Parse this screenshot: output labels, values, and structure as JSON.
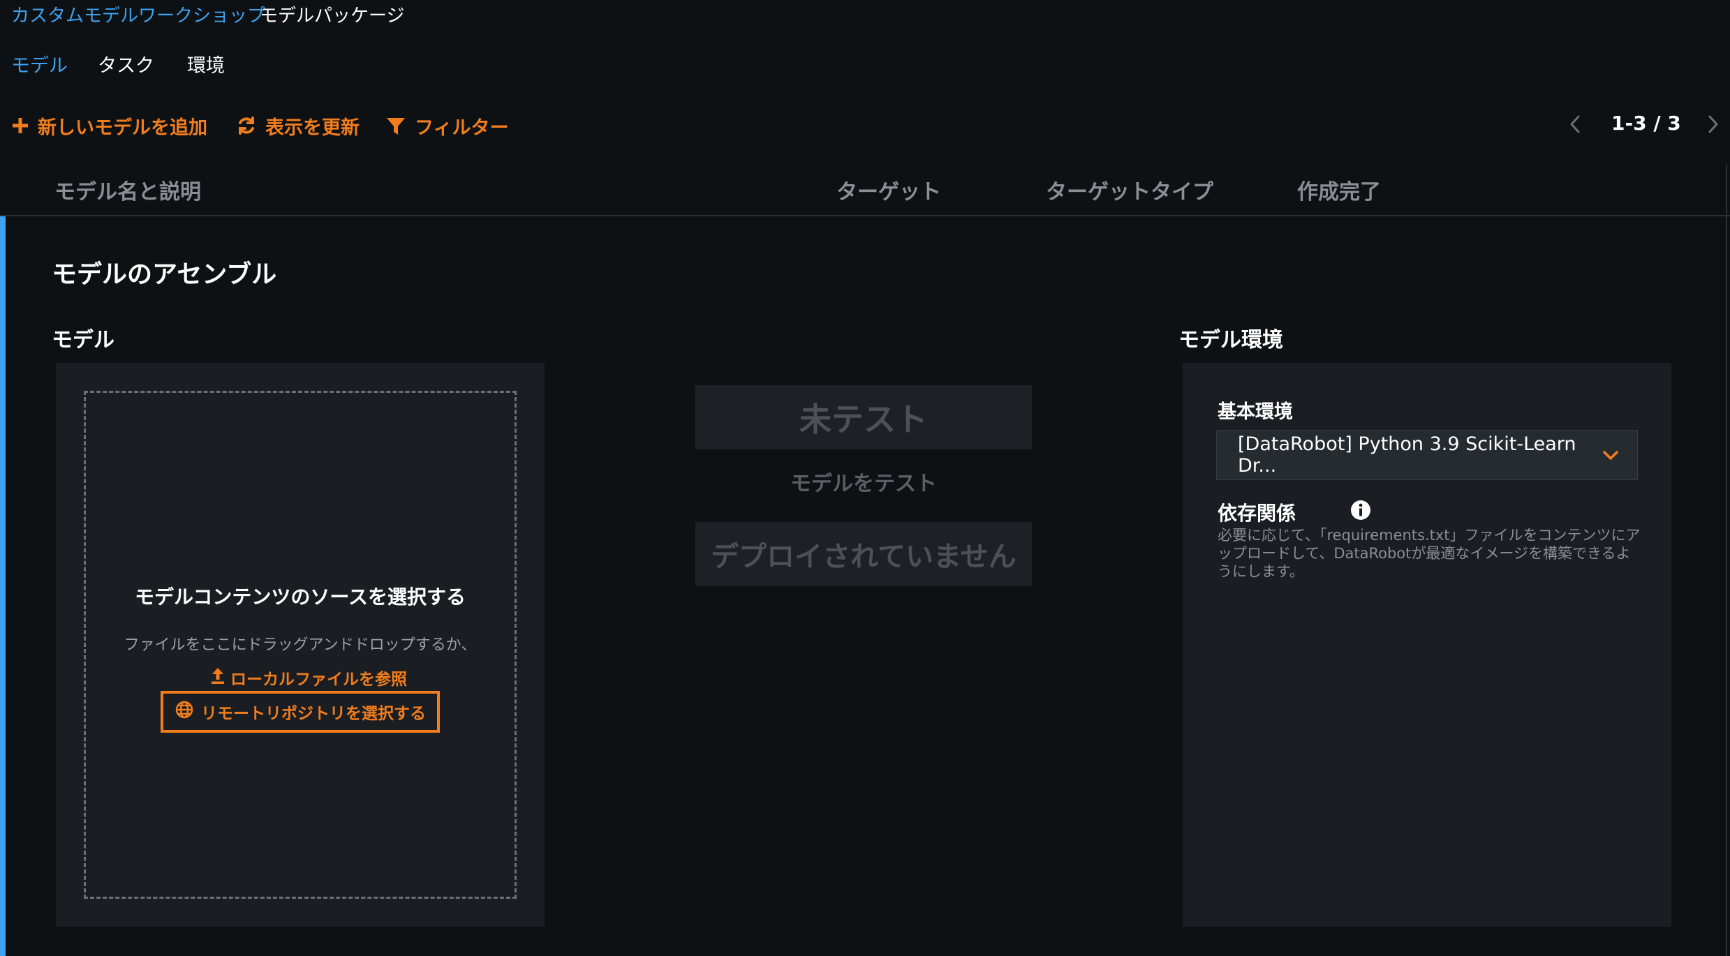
{
  "breadcrumb": {
    "parent": "カスタムモデルワークショップ",
    "current": "モデルパッケージ"
  },
  "tabs": [
    {
      "label": "モデル",
      "active": true
    },
    {
      "label": "タスク",
      "active": false
    },
    {
      "label": "環境",
      "active": false
    }
  ],
  "toolbar": {
    "add_model": "新しいモデルを追加",
    "refresh": "表示を更新",
    "filter": "フィルター",
    "pagination": "1-3 / 3"
  },
  "table_header": {
    "name": "モデル名と説明",
    "target": "ターゲット",
    "target_type": "ターゲットタイプ",
    "created": "作成完了"
  },
  "assembly": {
    "title": "モデルのアセンブル",
    "model_section": "モデル",
    "env_section": "モデル環境"
  },
  "dropzone": {
    "title": "モデルコンテンツのソースを選択する",
    "hint": "ファイルをここにドラッグアンドドロップするか、",
    "browse_local": "ローカルファイルを参照",
    "select_remote": "リモートリポジトリを選択する"
  },
  "status": {
    "untested": "未テスト",
    "test_model": "モデルをテスト",
    "not_deployed": "デプロイされていません"
  },
  "environment": {
    "base_label": "基本環境",
    "base_value": "[DataRobot] Python 3.9 Scikit-Learn Dr...",
    "dependencies_label": "依存関係",
    "dependencies_desc": "必要に応じて、「requirements.txt」ファイルをコンテンツにアップロードして、DataRobotが最適なイメージを構築できるようにします。"
  },
  "colors": {
    "background": "#0e1114",
    "panel": "#1a1e22",
    "accent_orange": "#f27d1c",
    "accent_blue": "#3fa2f0",
    "muted_text": "#8a8f95"
  },
  "icons": {
    "add": "plus-icon",
    "refresh": "refresh-icon",
    "filter": "filter-icon",
    "prev": "chevron-left-icon",
    "next": "chevron-right-icon",
    "upload": "upload-icon",
    "globe": "globe-icon",
    "dropdown": "chevron-down-icon",
    "info": "info-icon"
  }
}
